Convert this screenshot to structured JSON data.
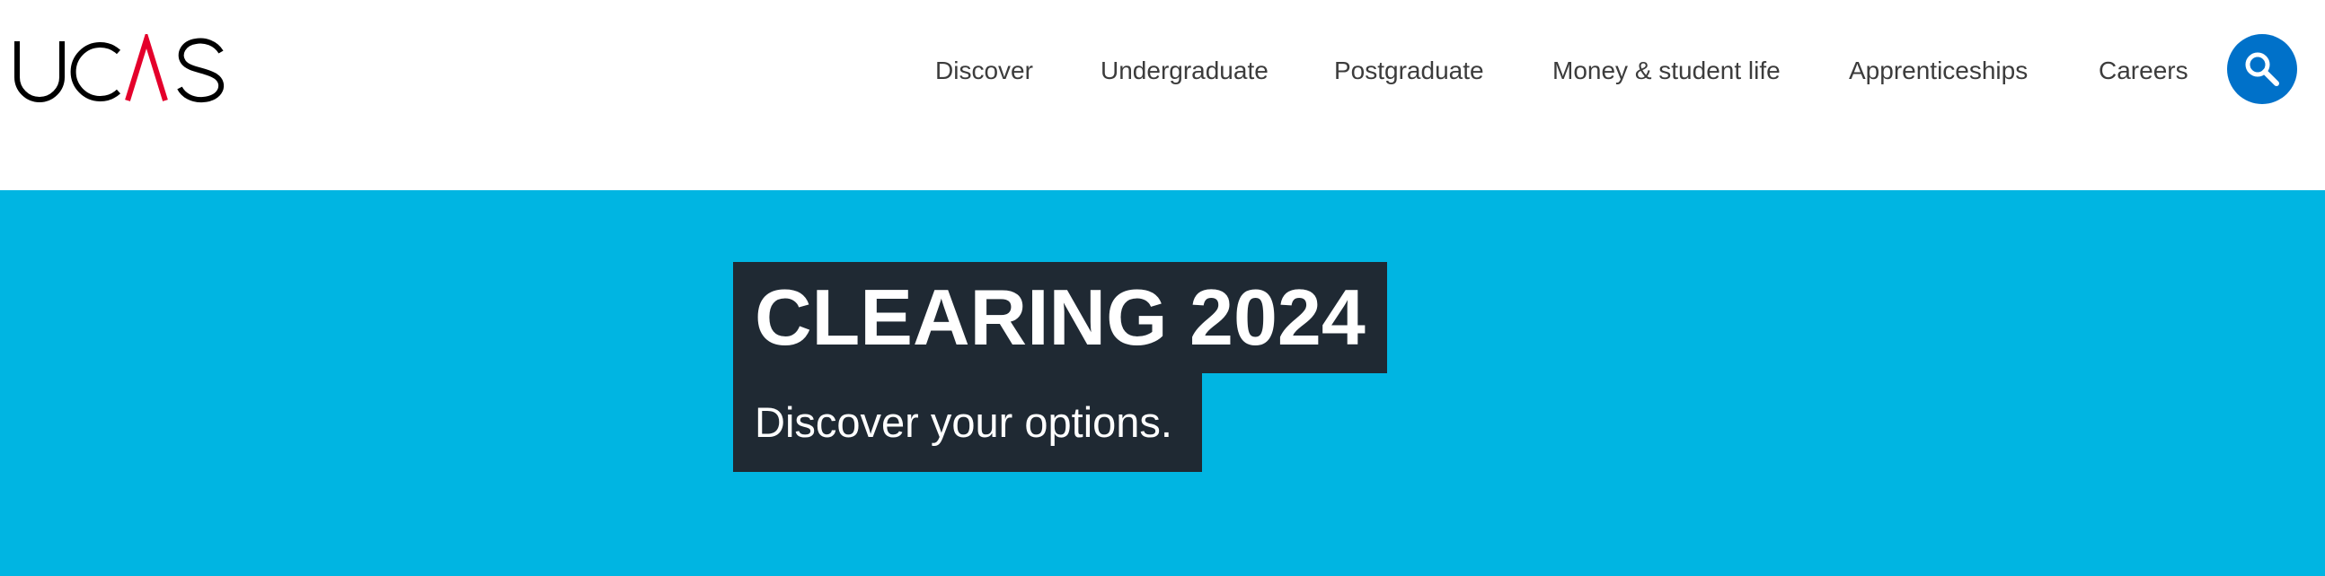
{
  "brand": {
    "name": "UCAS",
    "accent_color": "#e4002b"
  },
  "nav": {
    "items": [
      {
        "label": "Discover"
      },
      {
        "label": "Undergraduate"
      },
      {
        "label": "Postgraduate"
      },
      {
        "label": "Money & student life"
      },
      {
        "label": "Apprenticeships"
      },
      {
        "label": "Careers"
      }
    ],
    "search": {
      "icon": "search-icon",
      "color": "#0071c9"
    }
  },
  "hero": {
    "title": "CLEARING 2024",
    "subtitle": "Discover your options.",
    "background_color": "#00b5e2",
    "box_color": "#1f2933"
  }
}
